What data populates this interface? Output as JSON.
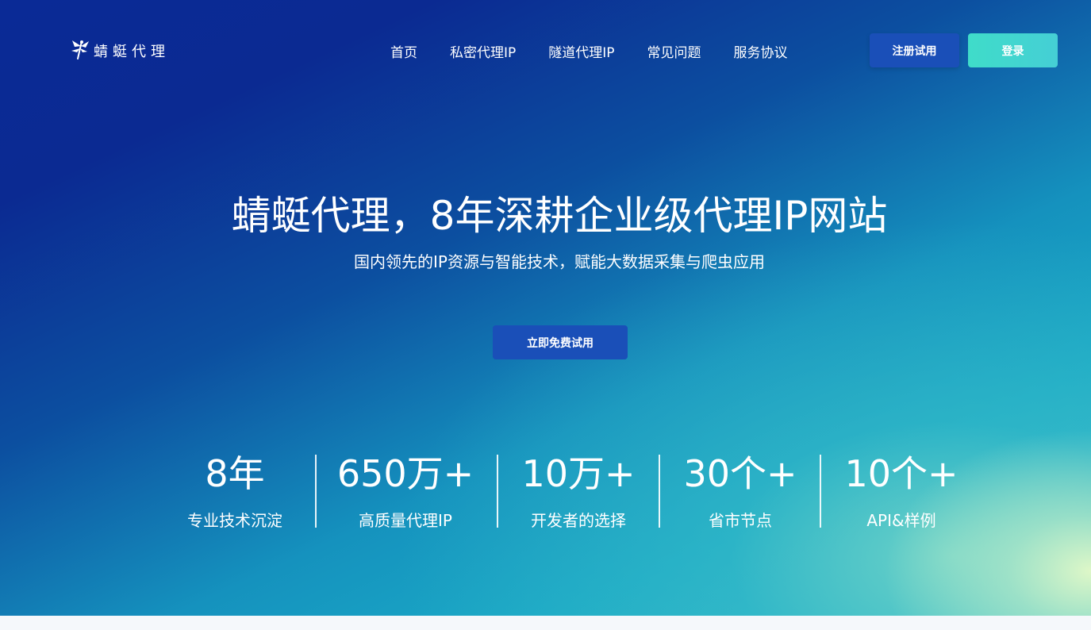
{
  "header": {
    "logo_text": "蜻蜓代理",
    "logo_icon": "dragonfly-icon",
    "nav": [
      {
        "label": "首页"
      },
      {
        "label": "私密代理IP"
      },
      {
        "label": "隧道代理IP"
      },
      {
        "label": "常见问题"
      },
      {
        "label": "服务协议"
      }
    ],
    "register_label": "注册试用",
    "login_label": "登录"
  },
  "hero": {
    "title": "蜻蜓代理，8年深耕企业级代理IP网站",
    "subtitle": "国内领先的IP资源与智能技术，赋能大数据采集与爬虫应用",
    "cta_label": "立即免费试用"
  },
  "stats": [
    {
      "value": "8年",
      "label": "专业技术沉淀"
    },
    {
      "value": "650万+",
      "label": "高质量代理IP"
    },
    {
      "value": "10万+",
      "label": "开发者的选择"
    },
    {
      "value": "30个+",
      "label": "省市节点"
    },
    {
      "value": "10个+",
      "label": "API&样例"
    }
  ],
  "colors": {
    "primary_button": "#1a4fb8",
    "login_button": "#3fdcc9",
    "text": "#ffffff"
  }
}
